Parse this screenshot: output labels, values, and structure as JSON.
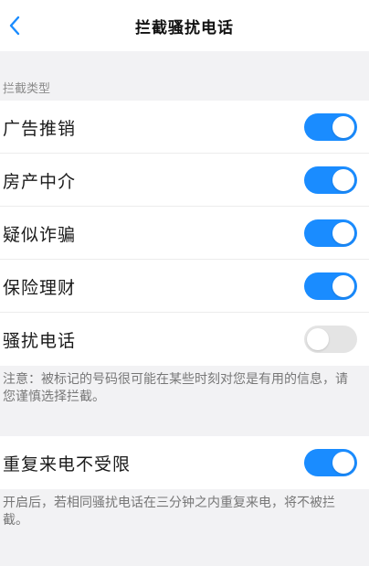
{
  "nav": {
    "title": "拦截骚扰电话",
    "back_icon": "chevron-left-icon"
  },
  "colors": {
    "accent": "#1a8cff",
    "toggle_off": "#e4e4e4",
    "background": "#f2f2f4"
  },
  "section": {
    "header": "拦截类型",
    "items": [
      {
        "label": "广告推销",
        "enabled": true
      },
      {
        "label": "房产中介",
        "enabled": true
      },
      {
        "label": "疑似诈骗",
        "enabled": true
      },
      {
        "label": "保险理财",
        "enabled": true
      },
      {
        "label": "骚扰电话",
        "enabled": false
      }
    ],
    "note": "注意：被标记的号码很可能在某些时刻对您是有用的信息，请您谨慎选择拦截。"
  },
  "repeat": {
    "label": "重复来电不受限",
    "enabled": true,
    "note": "开启后，若相同骚扰电话在三分钟之内重复来电，将不被拦截。"
  }
}
